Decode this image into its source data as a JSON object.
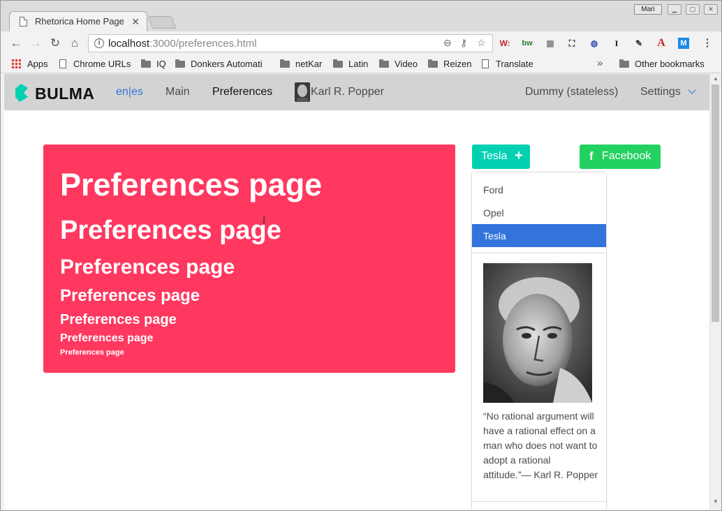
{
  "browser": {
    "tab_title": "Rhetorica Home Page",
    "profile_label": "Mari",
    "url_host": "localhost",
    "url_rest": ":3000/preferences.html",
    "extensions": [
      "W:",
      "bw",
      "grid",
      "capture",
      "globe",
      "I",
      "tool",
      "A",
      "M"
    ]
  },
  "bookmarks": {
    "items": [
      {
        "label": "Apps",
        "icon": "apps-icon"
      },
      {
        "label": "Chrome URLs",
        "icon": "page-icon"
      },
      {
        "label": "IQ",
        "icon": "folder-icon"
      },
      {
        "label": "Donkers Automati",
        "icon": "folder-icon"
      },
      {
        "label": "netKar",
        "icon": "folder-icon"
      },
      {
        "label": "Latin",
        "icon": "folder-icon"
      },
      {
        "label": "Video",
        "icon": "folder-icon"
      },
      {
        "label": "Reizen",
        "icon": "folder-icon"
      },
      {
        "label": "Translate",
        "icon": "page-icon"
      }
    ],
    "overflow": "»",
    "other": "Other bookmarks"
  },
  "navbar": {
    "brand": "BULMA",
    "lang": "en|es",
    "main": "Main",
    "preferences": "Preferences",
    "user": "Karl R. Popper",
    "dummy": "Dummy (stateless)",
    "settings": "Settings"
  },
  "hero": {
    "headings": [
      "Preferences page",
      "Preferences page",
      "Preferences page",
      "Preferences page",
      "Preferences page",
      "Preferences page",
      "Preferences page"
    ]
  },
  "buttons": {
    "tesla": "Tesla",
    "facebook": "Facebook"
  },
  "dropdown": {
    "items": [
      "Ford",
      "Opel",
      "Tesla"
    ],
    "selected": "Tesla",
    "quote": "“No rational argument will have a rational effect on a man who does not want to adopt a rational attitude.”— Karl R. Popper"
  },
  "colors": {
    "danger": "#ff3860",
    "primary": "#00d1b2",
    "success": "#23d160",
    "link": "#3273dc"
  }
}
